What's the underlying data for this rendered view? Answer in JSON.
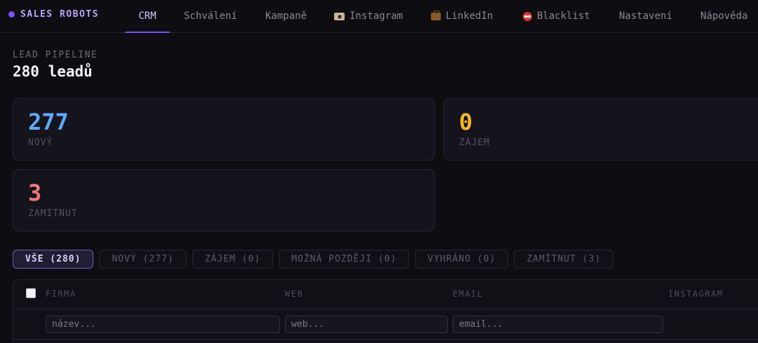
{
  "brand": {
    "name": "SALES ROBOTS",
    "accent": "#7c4dff"
  },
  "nav": [
    {
      "label": "CRM",
      "active": true,
      "icon": ""
    },
    {
      "label": "Schválení",
      "active": false,
      "icon": ""
    },
    {
      "label": "Kampaně",
      "active": false,
      "icon": ""
    },
    {
      "label": "Instagram",
      "active": false,
      "icon": "camera-icon"
    },
    {
      "label": "LinkedIn",
      "active": false,
      "icon": "briefcase-icon"
    },
    {
      "label": "Blacklist",
      "active": false,
      "icon": "no-entry-icon"
    },
    {
      "label": "Nastavení",
      "active": false,
      "icon": ""
    },
    {
      "label": "Nápověda",
      "active": false,
      "icon": ""
    }
  ],
  "header": {
    "eyebrow": "LEAD PIPELINE",
    "title": "280 leadů"
  },
  "stats": [
    {
      "value": "277",
      "label": "NOVÝ",
      "color": "#5fa8ff"
    },
    {
      "value": "0",
      "label": "ZÁJEM",
      "color": "#f5b829"
    },
    {
      "value": "3",
      "label": "ZAMÍTNUT",
      "color": "#f07878"
    }
  ],
  "filters": [
    {
      "label": "VŠE (280)",
      "active": true
    },
    {
      "label": "NOVÝ (277)",
      "active": false
    },
    {
      "label": "ZÁJEM (0)",
      "active": false
    },
    {
      "label": "MOŽNÁ POZDĚJI (0)",
      "active": false
    },
    {
      "label": "VYHRÁNO (0)",
      "active": false
    },
    {
      "label": "ZAMÍTNUT (3)",
      "active": false
    }
  ],
  "table": {
    "columns": [
      "FIRMA",
      "WEB",
      "EMAIL",
      "INSTAGRAM"
    ],
    "filter_placeholders": {
      "firma": "název...",
      "web": "web...",
      "email": "email..."
    }
  }
}
